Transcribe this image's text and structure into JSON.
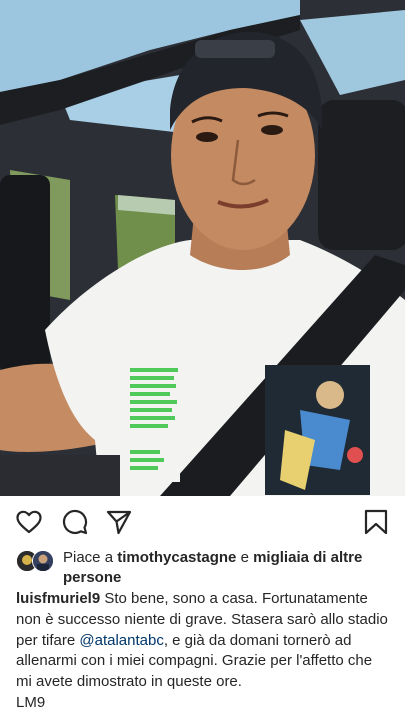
{
  "post": {
    "image_alt": "Selfie in car",
    "actions": {
      "like_icon": "heart-outline-icon",
      "comment_icon": "speech-bubble-icon",
      "share_icon": "paper-plane-icon",
      "save_icon": "bookmark-icon"
    },
    "likes": {
      "prefix": "Piace a ",
      "user": "timothycastagne",
      "connector": " e ",
      "others": "migliaia di altre persone"
    },
    "caption": {
      "username": "luisfmuriel9",
      "text_part1": " Sto bene, sono a casa. Fortunatamente non è successo niente di grave. Stasera sarò allo stadio per tifare ",
      "mention": "@atalantabc",
      "text_part2": ", e già da domani tornerò ad allenarmi con i miei compagni. Grazie per l'affetto che mi avete dimostrato in queste ore.",
      "signature": "LM9"
    }
  },
  "colors": {
    "text": "#262626",
    "mention": "#00376b",
    "background": "#ffffff"
  }
}
